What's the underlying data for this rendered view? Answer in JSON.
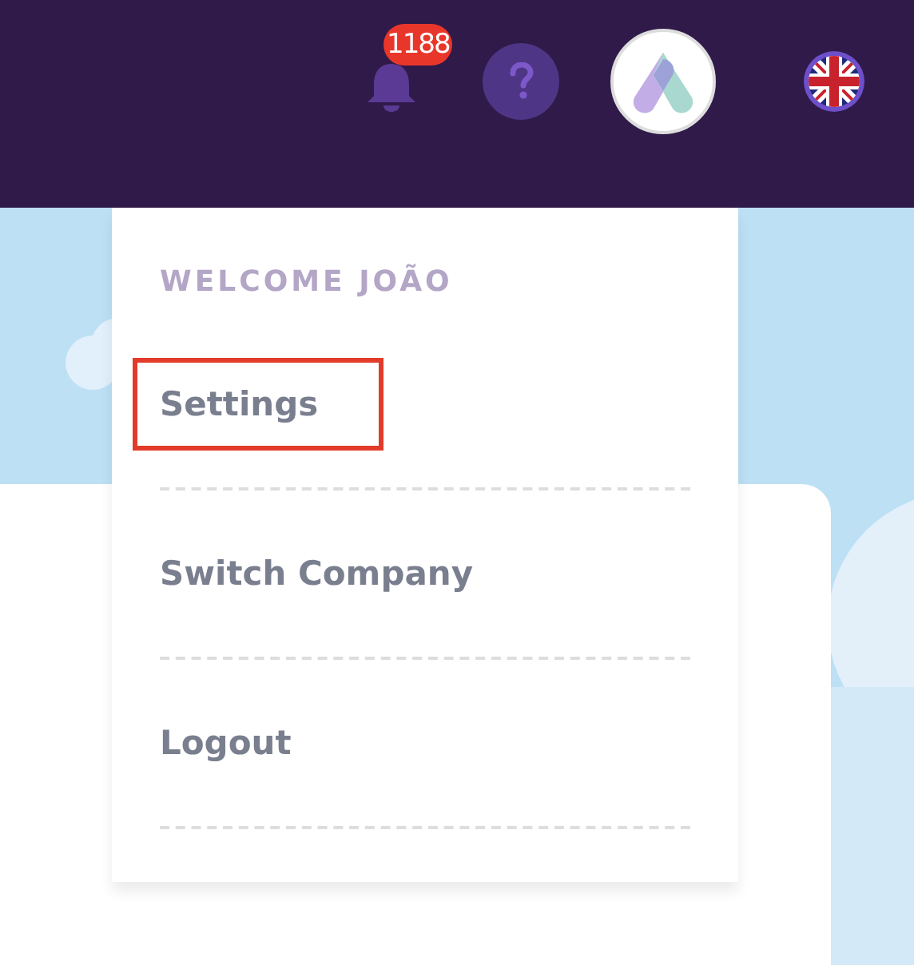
{
  "header": {
    "notifications": {
      "count": "1188"
    }
  },
  "menu": {
    "greeting": "WELCOME JOÃO",
    "items": [
      {
        "label": "Settings",
        "highlighted": true
      },
      {
        "label": "Switch Company",
        "highlighted": false
      },
      {
        "label": "Logout",
        "highlighted": false
      }
    ]
  }
}
